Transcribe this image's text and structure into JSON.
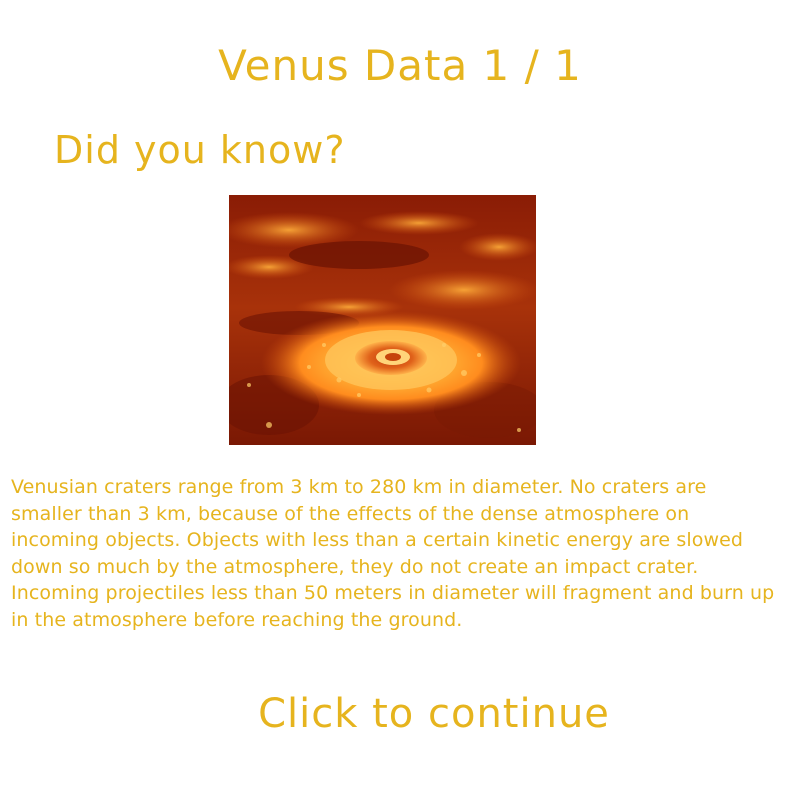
{
  "page": {
    "title": "Venus Data 1 / 1",
    "subtitle": "Did you know?",
    "image_name": "venus-crater-image",
    "body_text": "Venusian craters range from 3 km to 280 km in diameter. No craters are smaller than 3 km, because of the effects of the dense atmosphere on incoming objects. Objects with less than a certain kinetic energy are slowed down so much by the atmosphere, they do not create an impact crater. Incoming projectiles less than 50 meters in diameter will fragment and burn up in the atmosphere before reaching the ground.",
    "continue_label": "Click to continue"
  },
  "colors": {
    "text": "#e6b41e",
    "background": "#ffffff"
  }
}
